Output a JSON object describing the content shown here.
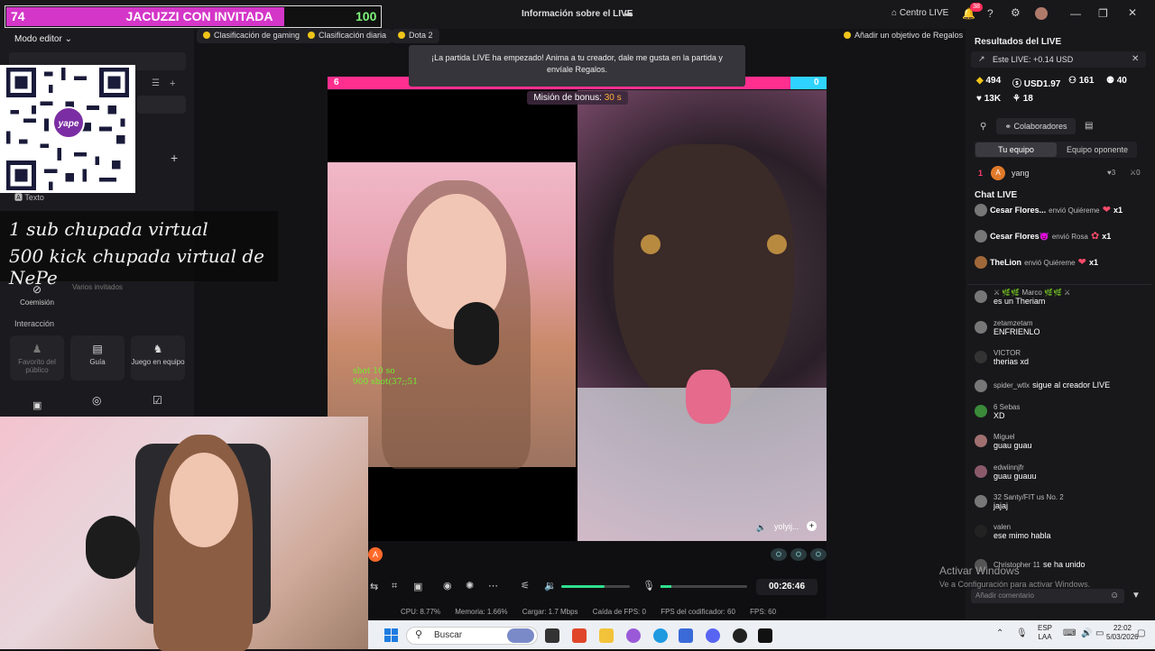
{
  "titlebar": {
    "title": "Información sobre el LIVE",
    "centro_live": "Centro LIVE",
    "notif_count": "38"
  },
  "score": {
    "left": "74",
    "center": "JACUZZI CON INVITADA",
    "right": "100",
    "fill_fraction": 0.74
  },
  "left_panel": {
    "editor_mode": "Modo editor",
    "texto": "Texto",
    "coemision": "Coemisión",
    "varios_invitados": "Varios invitados",
    "interaccion": "Interacción",
    "favorito": "Favorito del público",
    "guia": "Guía",
    "juego_equipo": "Juego en equipo"
  },
  "qr": {
    "brand": "yape"
  },
  "overlay_text": {
    "line1": "1 sub chupada virtual",
    "line2": "500 kick chupada virtual de NePe"
  },
  "chips": {
    "gaming": "Clasificación de gaming",
    "diaria": "Clasificación diaria",
    "dota": "Dota 2",
    "objetivo": "Añadir un objetivo de Regalos"
  },
  "battle": {
    "notice": "¡La partida LIVE ha empezado! Anima a tu creador, dale me gusta en la partida y envíale Regalos.",
    "left_score": "6",
    "right_score": "0",
    "bonus_label": "Misión de bonus:",
    "bonus_value": "30 s",
    "shot_lines": [
      "shot 10 so",
      "900 shot(37;;51"
    ],
    "guest_name": "yolyij..."
  },
  "controls": {
    "timer": "00:26:46",
    "volume_fraction": 0.63
  },
  "stats": {
    "cpu": "CPU: 8.77%",
    "memoria": "Memoria: 1.66%",
    "cargar": "Cargar: 1.7 Mbps",
    "fps_drop": "Caída de FPS: 0",
    "fps_encoder": "FPS del codificador: 60",
    "fps": "FPS: 60"
  },
  "right_panel": {
    "title": "Resultados del LIVE",
    "este_live": "Este LIVE: +0.14 USD",
    "stats": [
      "494",
      "USD1.97",
      "161",
      "40",
      "13K",
      "18"
    ],
    "colaboradores": "Colaboradores",
    "tu_equipo": "Tu equipo",
    "equipo_oponente": "Equipo oponente",
    "rank_num": "1",
    "rank_user": "yang",
    "rank_likes": "3",
    "rank_score": "0",
    "chat_title": "Chat LIVE",
    "gifts": [
      {
        "name": "Cesar Flores...",
        "text": "envió Quiéreme",
        "count": "x1"
      },
      {
        "name": "Cesar Flores😈",
        "text": "envió Rosa",
        "count": "x1"
      },
      {
        "name": "TheLion",
        "text": "envió Quiéreme",
        "count": "x1"
      }
    ],
    "messages": [
      {
        "user": "⚔ 🌿🌿 Marco 🌿🌿 ⚔",
        "text": "es un Theriam"
      },
      {
        "user": "zetamzetam",
        "text": "ENFRIENLO"
      },
      {
        "user": "VICTOR",
        "text": "therias xd"
      },
      {
        "user": "spider_wtlx",
        "text": "sigue al creador LIVE"
      },
      {
        "user": "6 Sebas",
        "text": "XD"
      },
      {
        "user": "Miguel",
        "text": "guau guau"
      },
      {
        "user": "edwiinnjfr",
        "text": "guau guauu"
      },
      {
        "user": "32 Santy/FIT us No. 2",
        "text": "jajaj"
      },
      {
        "user": "valen",
        "text": "ese mimo habla"
      },
      {
        "user": "Christopher 11",
        "text": "se ha unido"
      }
    ],
    "comment_placeholder": "Añadir comentario"
  },
  "watermark": {
    "line1": "Activar Windows",
    "line2": "Ve a Configuración para activar Windows."
  },
  "taskbar": {
    "search": "Buscar",
    "lang1": "ESP",
    "lang2": "LAA",
    "time": "22:02",
    "date": "5/03/2026"
  }
}
